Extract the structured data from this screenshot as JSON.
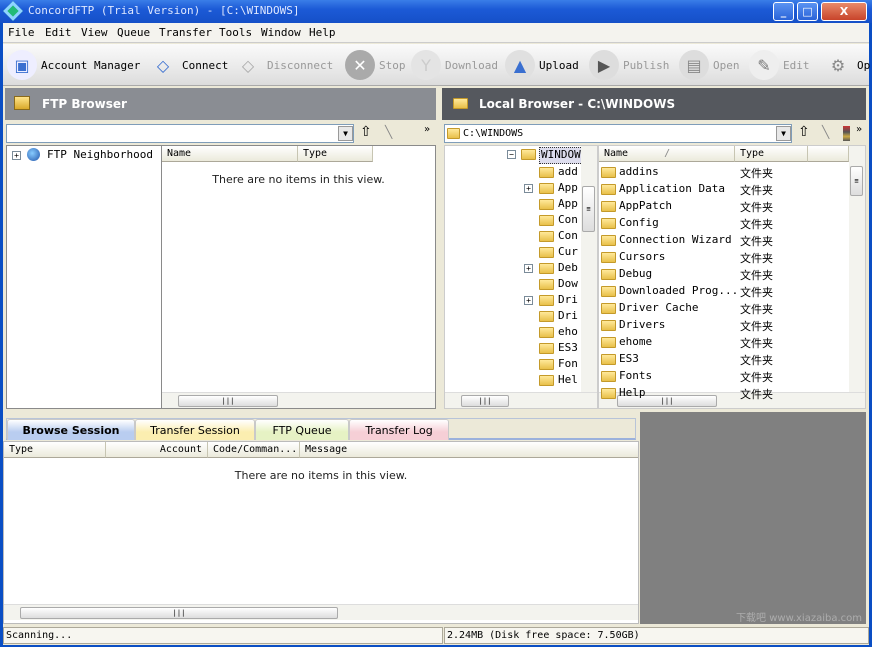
{
  "window": {
    "title": "ConcordFTP (Trial Version) - [C:\\WINDOWS]",
    "min": "_",
    "max": "□",
    "close": "X"
  },
  "menu": [
    "File",
    "Edit",
    "View",
    "Queue",
    "Transfer",
    "Tools",
    "Window",
    "Help"
  ],
  "toolbar": [
    {
      "label": "Account Manager",
      "icon": "account-manager-icon",
      "enabled": true
    },
    {
      "label": "Connect",
      "icon": "connect-icon",
      "enabled": true
    },
    {
      "label": "Disconnect",
      "icon": "disconnect-icon",
      "enabled": false
    },
    {
      "label": "Stop",
      "icon": "stop-icon",
      "enabled": false
    },
    {
      "label": "Download",
      "icon": "download-icon",
      "enabled": false
    },
    {
      "label": "Upload",
      "icon": "upload-icon",
      "enabled": true
    },
    {
      "label": "Publish",
      "icon": "publish-icon",
      "enabled": false
    },
    {
      "label": "Open",
      "icon": "open-icon",
      "enabled": false
    },
    {
      "label": "Edit",
      "icon": "edit-icon",
      "enabled": false
    },
    {
      "label": "Op",
      "icon": "options-gear-icon",
      "enabled": true
    }
  ],
  "ftp": {
    "title": "FTP Browser",
    "path": "",
    "tree": [
      "FTP Neighborhood"
    ],
    "cols": [
      "Name",
      "Type"
    ],
    "empty": "There are no items in this view."
  },
  "local": {
    "title": "Local Browser - C:\\WINDOWS",
    "path": "C:\\WINDOWS",
    "tree_root": "WINDOW",
    "tree": [
      {
        "n": "add",
        "p": false
      },
      {
        "n": "App",
        "p": true
      },
      {
        "n": "App",
        "p": false
      },
      {
        "n": "Con",
        "p": false
      },
      {
        "n": "Con",
        "p": false
      },
      {
        "n": "Cur",
        "p": false
      },
      {
        "n": "Deb",
        "p": true
      },
      {
        "n": "Dow",
        "p": false
      },
      {
        "n": "Dri",
        "p": true
      },
      {
        "n": "Dri",
        "p": false
      },
      {
        "n": "eho",
        "p": false
      },
      {
        "n": "ES3",
        "p": false
      },
      {
        "n": "Fon",
        "p": false
      },
      {
        "n": "Hel",
        "p": false
      }
    ],
    "cols": [
      "Name",
      "Type"
    ],
    "sort_indicator": "/",
    "files": [
      {
        "n": "addins",
        "t": "文件夹"
      },
      {
        "n": "Application Data",
        "t": "文件夹"
      },
      {
        "n": "AppPatch",
        "t": "文件夹"
      },
      {
        "n": "Config",
        "t": "文件夹"
      },
      {
        "n": "Connection Wizard",
        "t": "文件夹"
      },
      {
        "n": "Cursors",
        "t": "文件夹"
      },
      {
        "n": "Debug",
        "t": "文件夹"
      },
      {
        "n": "Downloaded Prog...",
        "t": "文件夹"
      },
      {
        "n": "Driver Cache",
        "t": "文件夹"
      },
      {
        "n": "Drivers",
        "t": "文件夹"
      },
      {
        "n": "ehome",
        "t": "文件夹"
      },
      {
        "n": "ES3",
        "t": "文件夹"
      },
      {
        "n": "Fonts",
        "t": "文件夹"
      },
      {
        "n": "Help",
        "t": "文件夹"
      }
    ]
  },
  "session": {
    "tabs": [
      {
        "label": "Browse Session",
        "color": "#b9cdf0"
      },
      {
        "label": "Transfer Session",
        "color": "#fbeeb0"
      },
      {
        "label": "FTP Queue",
        "color": "#e6f2c4"
      },
      {
        "label": "Transfer Log",
        "color": "#f6cfd6"
      }
    ],
    "cols": [
      "Type",
      "Account",
      "Code/Comman...",
      "Message"
    ],
    "empty": "There are no items in this view."
  },
  "status": {
    "left": "Scanning...",
    "right": "2.24MB (Disk free space: 7.50GB)"
  },
  "watermark": "下载吧 www.xiazaiba.com"
}
